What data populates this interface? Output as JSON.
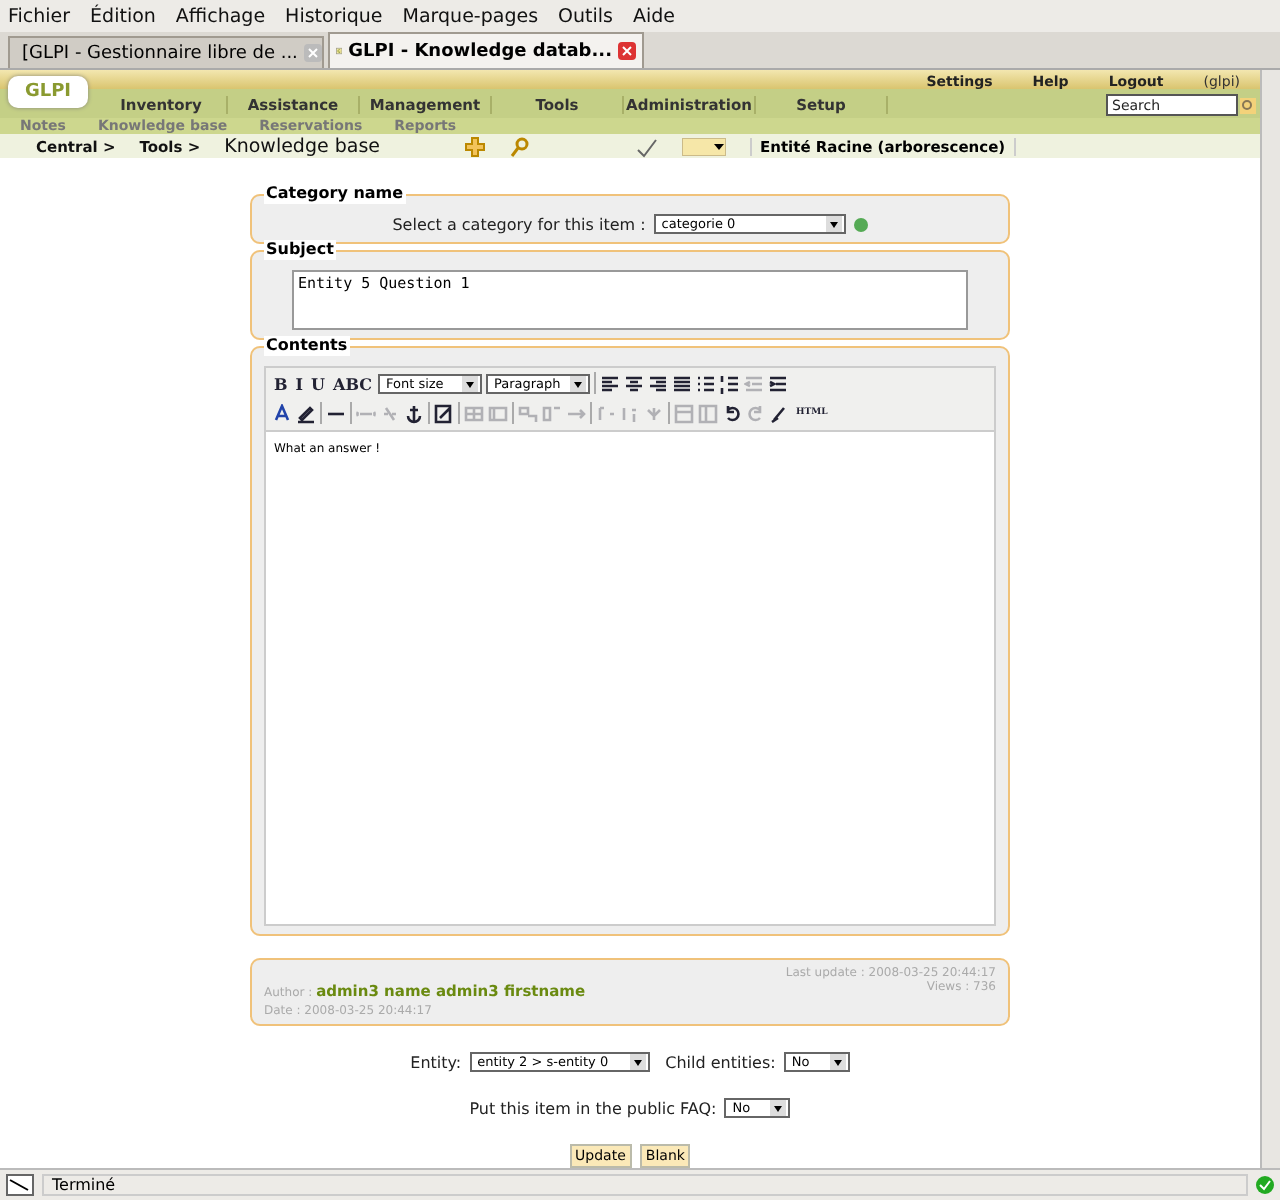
{
  "menu_bar": [
    "Fichier",
    "Édition",
    "Affichage",
    "Historique",
    "Marque-pages",
    "Outils",
    "Aide"
  ],
  "browser_tabs": [
    {
      "title": "[GLPI - Gestionnaire libre de ...",
      "selected": false
    },
    {
      "title": "GLPI - Knowledge datab...",
      "selected": true
    }
  ],
  "header": {
    "logo": "GLPI",
    "links": [
      "Settings",
      "Help",
      "Logout"
    ],
    "user": "(glpi)",
    "search": {
      "placeholder": "Search"
    },
    "nav": [
      "Inventory",
      "Assistance",
      "Management",
      "Tools",
      "Administration",
      "Setup"
    ],
    "subnav": [
      "Notes",
      "Knowledge base",
      "Reservations",
      "Reports"
    ]
  },
  "breadcrumb": {
    "items": [
      "Central >",
      "Tools >"
    ],
    "title": "Knowledge base",
    "entity": "Entité Racine (arborescence)"
  },
  "category": {
    "legend": "Category name",
    "label": "Select a category for this item :",
    "value": "categorie 0"
  },
  "subject": {
    "legend": "Subject",
    "value": "Entity 5 Question 1"
  },
  "contents": {
    "legend": "Contents",
    "text": "What an answer !",
    "toolbar_rows": [
      [
        {
          "kind": "button",
          "label": "B"
        },
        {
          "kind": "button",
          "label": "I"
        },
        {
          "kind": "button",
          "label": "U"
        },
        {
          "kind": "button",
          "label": "ABC"
        },
        {
          "kind": "select",
          "value": "Font size"
        },
        {
          "kind": "select",
          "value": "Paragraph"
        },
        {
          "kind": "separator"
        },
        {
          "kind": "icon",
          "disabled": false
        },
        {
          "kind": "icon",
          "disabled": false
        },
        {
          "kind": "icon",
          "disabled": false
        },
        {
          "kind": "icon",
          "disabled": false
        },
        {
          "kind": "icon",
          "disabled": false
        },
        {
          "kind": "icon",
          "disabled": false
        },
        {
          "kind": "icon",
          "disabled": true
        },
        {
          "kind": "icon",
          "disabled": false
        }
      ],
      [
        {
          "kind": "icon",
          "disabled": false
        },
        {
          "kind": "icon",
          "disabled": false
        },
        {
          "kind": "separator"
        },
        {
          "kind": "icon",
          "disabled": false
        },
        {
          "kind": "separator"
        },
        {
          "kind": "icon",
          "disabled": true
        },
        {
          "kind": "icon",
          "disabled": true
        },
        {
          "kind": "icon",
          "disabled": false
        },
        {
          "kind": "separator"
        },
        {
          "kind": "icon",
          "disabled": false
        },
        {
          "kind": "separator"
        },
        {
          "kind": "icon",
          "disabled": true
        },
        {
          "kind": "icon",
          "disabled": true
        },
        {
          "kind": "separator"
        },
        {
          "kind": "icon",
          "disabled": true
        },
        {
          "kind": "icon",
          "disabled": true
        },
        {
          "kind": "icon",
          "disabled": true
        },
        {
          "kind": "separator"
        },
        {
          "kind": "icon",
          "disabled": true
        },
        {
          "kind": "icon",
          "disabled": true
        },
        {
          "kind": "icon",
          "disabled": true
        },
        {
          "kind": "separator"
        },
        {
          "kind": "icon",
          "disabled": true
        },
        {
          "kind": "icon",
          "disabled": true
        },
        {
          "kind": "icon",
          "disabled": false
        },
        {
          "kind": "icon",
          "disabled": true
        },
        {
          "kind": "icon",
          "disabled": false
        },
        {
          "kind": "button",
          "label": "HTML"
        }
      ]
    ]
  },
  "info": {
    "author_label": "Author :",
    "author": "admin3 name admin3 firstname",
    "date": "Date : 2008-03-25 20:44:17",
    "last_update": "Last update : 2008-03-25 20:44:17",
    "views": "Views : 736"
  },
  "entity_row": {
    "label": "Entity:",
    "value": "entity 2 > s-entity 0",
    "child_label": "Child entities:",
    "child_value": "No"
  },
  "faq_row": {
    "label": "Put this item in the public FAQ:",
    "value": "No"
  },
  "buttons": [
    "Update",
    "Blank"
  ],
  "status_bar": {
    "text": "Terminé"
  }
}
